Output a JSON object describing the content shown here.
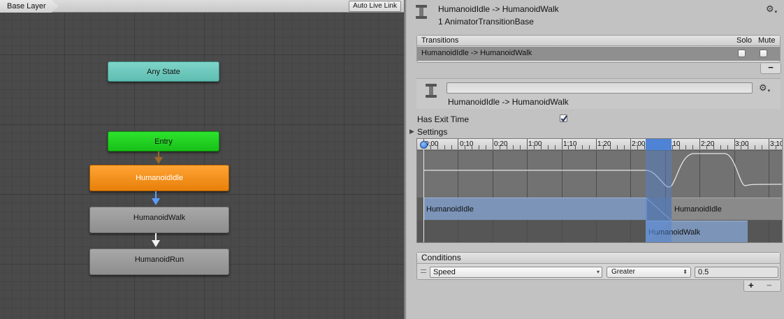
{
  "graph": {
    "breadcrumb": "Base Layer",
    "auto_live_link": "Auto Live Link",
    "nodes": {
      "any_state": "Any State",
      "entry": "Entry",
      "idle": "HumanoidIdle",
      "walk": "HumanoidWalk",
      "run": "HumanoidRun"
    },
    "colors": {
      "any_state": "#6cc7bb",
      "entry": "#22d222",
      "idle_active": "#f4900f",
      "state": "#9c9c9c",
      "selected_transition": "#5a9dff"
    }
  },
  "inspector": {
    "header": {
      "title": "HumanoidIdle -> HumanoidWalk",
      "subtitle": "1 AnimatorTransitionBase"
    },
    "transitions": {
      "heading": "Transitions",
      "solo": "Solo",
      "mute": "Mute",
      "rows": [
        {
          "label": "HumanoidIdle -> HumanoidWalk",
          "solo": false,
          "mute": false
        }
      ],
      "remove_label": "−"
    },
    "transition": {
      "name_value": "",
      "title": "HumanoidIdle -> HumanoidWalk",
      "has_exit_time_label": "Has Exit Time",
      "has_exit_time": true,
      "settings_label": "Settings"
    },
    "timeline": {
      "ticks": [
        "0:00",
        "0:10",
        "0:20",
        "1:00",
        "1:10",
        "1:20",
        "2:00",
        "2:10",
        "2:20",
        "3:00",
        "3:10"
      ],
      "clip_source": "HumanoidIdle",
      "clip_source_after": "HumanoidIdle",
      "clip_dest": "HumanoidWalk"
    },
    "conditions": {
      "heading": "Conditions",
      "parameter": "Speed",
      "operator": "Greater",
      "value": "0.5",
      "add_label": "+",
      "remove_label": "−"
    }
  }
}
